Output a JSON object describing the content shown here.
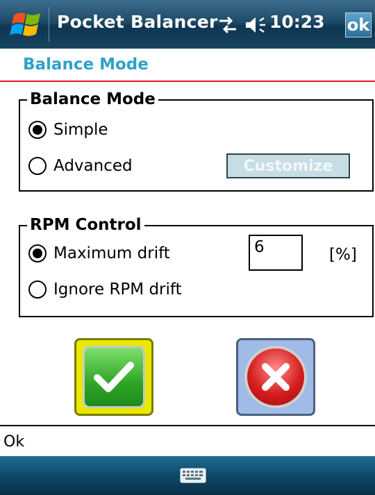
{
  "titlebar": {
    "app_title": "Pocket Balancer",
    "time": "10:23",
    "ok_label": "ok",
    "icons": [
      "windows-start-icon",
      "connectivity-icon",
      "volume-icon"
    ]
  },
  "header": {
    "title": "Balance Mode"
  },
  "balance_mode": {
    "legend": "Balance Mode",
    "options": [
      {
        "label": "Simple",
        "checked": true
      },
      {
        "label": "Advanced",
        "checked": false
      }
    ],
    "customize_label": "Customize"
  },
  "rpm_control": {
    "legend": "RPM Control",
    "options": [
      {
        "label": "Maximum drift",
        "checked": true
      },
      {
        "label": "Ignore RPM drift",
        "checked": false
      }
    ],
    "drift_value": "6",
    "unit": "[%]"
  },
  "actions": {
    "ok_icon": "checkmark-icon",
    "cancel_icon": "cancel-x-icon"
  },
  "status": {
    "text": "Ok"
  },
  "bottom_bar": {
    "icon": "keyboard-icon"
  },
  "colors": {
    "accent": "#2fa2c8",
    "separator": "#e2141a",
    "ok_highlight": "#e8e800",
    "cancel_frame": "#9fbbe6"
  }
}
